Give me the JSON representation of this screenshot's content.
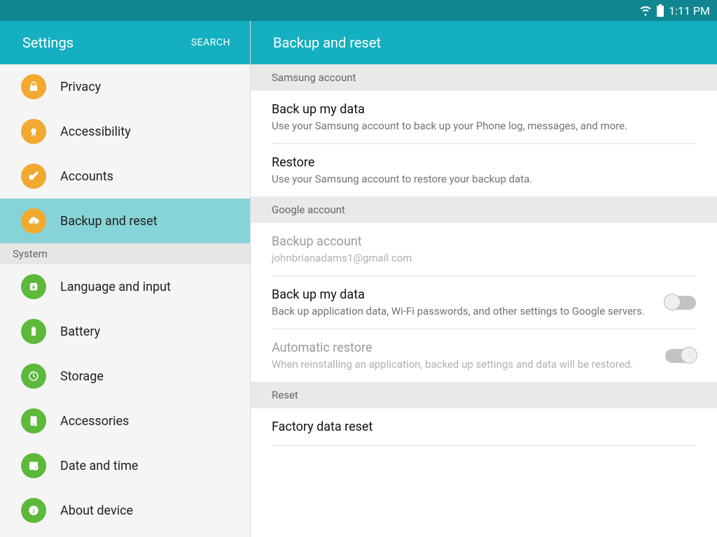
{
  "status": {
    "time": "1:11 PM"
  },
  "colors": {
    "orange": "#f2a930",
    "green": "#5db83b"
  },
  "sidebar": {
    "title": "Settings",
    "search": "SEARCH",
    "items": [
      {
        "label": "Privacy",
        "icon": "privacy",
        "color": "orange"
      },
      {
        "label": "Accessibility",
        "icon": "accessibility",
        "color": "orange"
      },
      {
        "label": "Accounts",
        "icon": "accounts",
        "color": "orange"
      },
      {
        "label": "Backup and reset",
        "icon": "backup",
        "color": "orange"
      }
    ],
    "section": "System",
    "system_items": [
      {
        "label": "Language and input",
        "icon": "language",
        "color": "green"
      },
      {
        "label": "Battery",
        "icon": "battery",
        "color": "green"
      },
      {
        "label": "Storage",
        "icon": "storage",
        "color": "green"
      },
      {
        "label": "Accessories",
        "icon": "accessories",
        "color": "green"
      },
      {
        "label": "Date and time",
        "icon": "datetime",
        "color": "green"
      },
      {
        "label": "About device",
        "icon": "about",
        "color": "green"
      }
    ]
  },
  "content": {
    "title": "Backup and reset",
    "groups": {
      "samsung": {
        "header": "Samsung account",
        "backup_title": "Back up my data",
        "backup_sub": "Use your Samsung account to back up your Phone log, messages, and more.",
        "restore_title": "Restore",
        "restore_sub": "Use your Samsung account to restore your backup data."
      },
      "google": {
        "header": "Google account",
        "account_title": "Backup account",
        "account_sub": "johnbrianadams1@gmail.com",
        "backup_title": "Back up my data",
        "backup_sub": "Back up application data, Wi-Fi passwords, and other settings to Google servers.",
        "auto_title": "Automatic restore",
        "auto_sub": "When reinstalling an application, backed up settings and data will be restored."
      },
      "reset": {
        "header": "Reset",
        "factory_title": "Factory data reset"
      }
    }
  }
}
